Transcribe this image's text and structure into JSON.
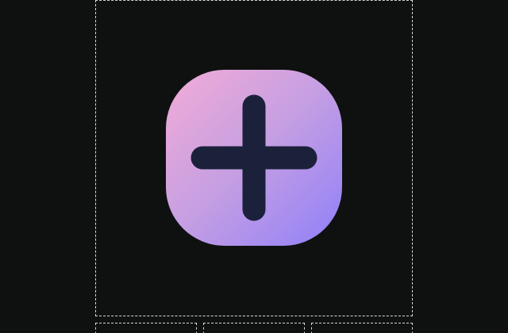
{
  "icon": {
    "name": "plus-icon",
    "glyph_color": "#1b213a",
    "gradient": [
      "#f3acd6",
      "#c49ee3",
      "#8f80f9"
    ]
  },
  "colors": {
    "background": "#0f1110",
    "frame_border": "#d8dad8"
  },
  "thumbnails": [
    "",
    "",
    ""
  ]
}
